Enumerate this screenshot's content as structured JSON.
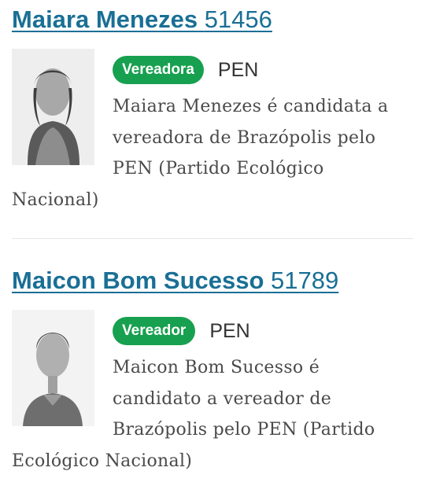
{
  "candidates": [
    {
      "name": "Maiara Menezes",
      "number": "51456",
      "role": "Vereadora",
      "party": "PEN",
      "description": "Maiara Menezes é candidata a vereadora de Brazópolis pelo PEN (Partido Ecológico Nacional)"
    },
    {
      "name": "Maicon Bom Sucesso",
      "number": "51789",
      "role": "Vereador",
      "party": "PEN",
      "description": "Maicon Bom Sucesso é candidato a vereador de Brazópolis pelo PEN (Partido Ecológico Nacional)"
    }
  ],
  "colors": {
    "link": "#1a6f95",
    "badge": "#17a04f",
    "text": "#4a4a4a"
  }
}
